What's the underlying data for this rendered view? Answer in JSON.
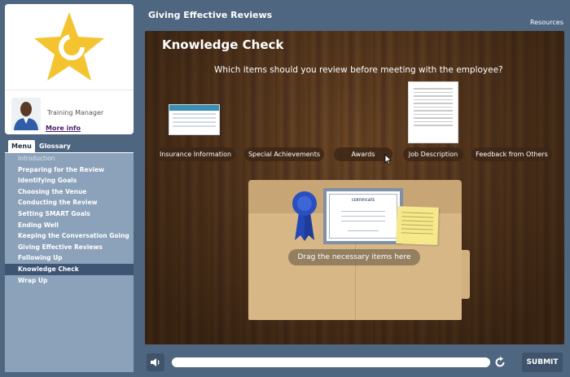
{
  "app": {
    "course_title": "Giving Effective Reviews",
    "resources_label": "Resources"
  },
  "presenter": {
    "title": "Training Manager",
    "more_info": "More info"
  },
  "menu": {
    "tabs": [
      {
        "label": "Menu",
        "active": true
      },
      {
        "label": "Glossary",
        "active": false
      }
    ],
    "items": [
      {
        "label": "Introduction",
        "state": "visited"
      },
      {
        "label": "Preparing for the Review"
      },
      {
        "label": "Identifying Goals"
      },
      {
        "label": "Choosing the Venue"
      },
      {
        "label": "Conducting the Review"
      },
      {
        "label": "Setting SMART Goals"
      },
      {
        "label": "Ending Well"
      },
      {
        "label": "Keeping the Conversation Going"
      },
      {
        "label": "Giving Effective Reviews"
      },
      {
        "label": "Following Up"
      },
      {
        "label": "Knowledge Check",
        "state": "active"
      },
      {
        "label": "Wrap Up"
      }
    ]
  },
  "slide": {
    "title": "Knowledge Check",
    "question": "Which items should you review before meeting with the employee?",
    "options": [
      "Insurance Information",
      "Special Achievements",
      "Awards",
      "Job Description",
      "Feedback from Others"
    ],
    "drop_label": "Drag the necessary items here",
    "certificate_text": "CERTIFICATE"
  },
  "controls": {
    "submit_label": "SUBMIT"
  },
  "colors": {
    "background": "#4f6680",
    "menu_panel": "#8ba2ba",
    "menu_active": "#3d5472",
    "logo_star": "#f4c430",
    "ribbon": "#2a4fbf"
  },
  "icons": {
    "logo": "star-logo-icon",
    "audio": "speaker-icon",
    "replay": "replay-icon",
    "cursor": "mouse-cursor-icon"
  }
}
